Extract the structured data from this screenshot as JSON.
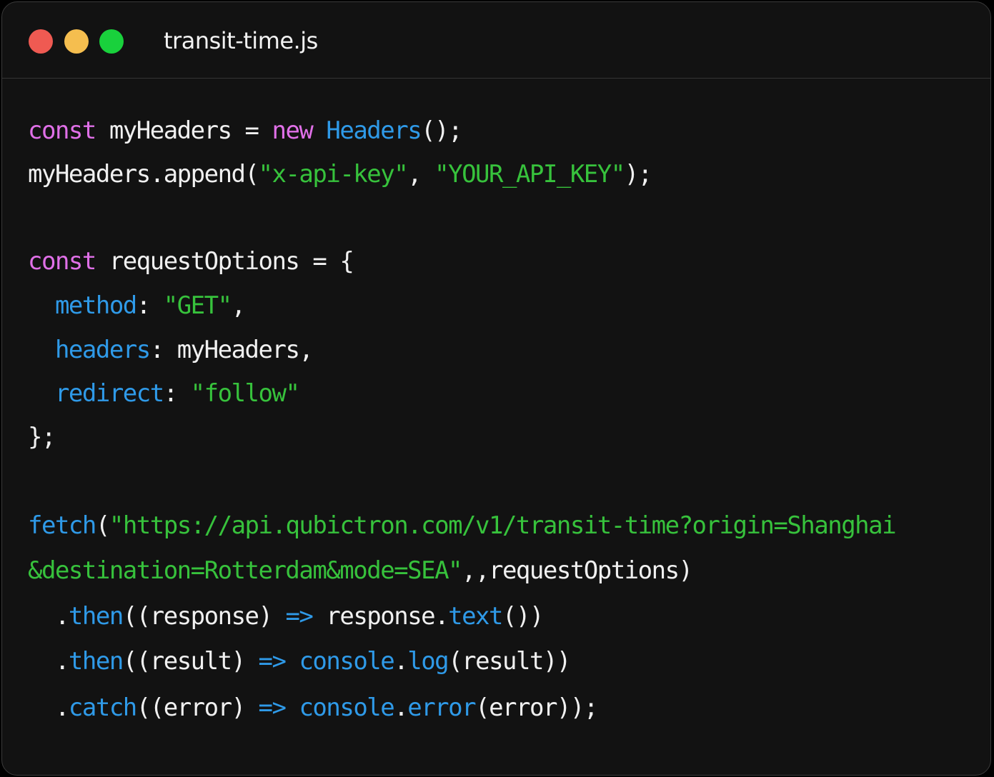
{
  "window": {
    "title": "transit-time.js"
  },
  "colors": {
    "keyword": "#e070e8",
    "function": "#2f9ae8",
    "string": "#37c23c",
    "plain": "#f0f0f0",
    "background": "#121212",
    "close": "#ef5a52",
    "minimize": "#f5be4f",
    "maximize": "#19d13c"
  },
  "code": {
    "lines": [
      {
        "tokens": [
          {
            "t": "const",
            "c": "kw"
          },
          {
            "t": " myHeaders = ",
            "c": "pl"
          },
          {
            "t": "new",
            "c": "kw"
          },
          {
            "t": " ",
            "c": "pl"
          },
          {
            "t": "Headers",
            "c": "fn"
          },
          {
            "t": "();",
            "c": "pl"
          }
        ]
      },
      {
        "tokens": [
          {
            "t": "myHeaders.append(",
            "c": "pl"
          },
          {
            "t": "\"x-api-key\"",
            "c": "str"
          },
          {
            "t": ", ",
            "c": "pl"
          },
          {
            "t": "\"YOUR_API_KEY\"",
            "c": "str"
          },
          {
            "t": ");",
            "c": "pl"
          }
        ]
      },
      {
        "tokens": []
      },
      {
        "tokens": [
          {
            "t": "const",
            "c": "kw"
          },
          {
            "t": " requestOptions = {",
            "c": "pl"
          }
        ]
      },
      {
        "tokens": [
          {
            "t": "  ",
            "c": "pl"
          },
          {
            "t": "method",
            "c": "fn"
          },
          {
            "t": ": ",
            "c": "pl"
          },
          {
            "t": "\"GET\"",
            "c": "str"
          },
          {
            "t": ",",
            "c": "pl"
          }
        ]
      },
      {
        "tokens": [
          {
            "t": "  ",
            "c": "pl"
          },
          {
            "t": "headers",
            "c": "fn"
          },
          {
            "t": ": myHeaders,",
            "c": "pl"
          }
        ]
      },
      {
        "tokens": [
          {
            "t": "  ",
            "c": "pl"
          },
          {
            "t": "redirect",
            "c": "fn"
          },
          {
            "t": ": ",
            "c": "pl"
          },
          {
            "t": "\"follow\"",
            "c": "str"
          }
        ]
      },
      {
        "tokens": [
          {
            "t": "};",
            "c": "pl"
          }
        ]
      },
      {
        "tokens": []
      },
      {
        "tokens": [
          {
            "t": "fetch",
            "c": "fn"
          },
          {
            "t": "(",
            "c": "pl"
          },
          {
            "t": "\"https://api.qubictron.com/v1/transit-time?origin=Shanghai",
            "c": "str"
          }
        ]
      },
      {
        "tokens": [
          {
            "t": "&destination=Rotterdam&mode=SEA\"",
            "c": "str"
          },
          {
            "t": ",,requestOptions)",
            "c": "pl"
          }
        ]
      },
      {
        "tokens": [
          {
            "t": "  .",
            "c": "pl"
          },
          {
            "t": "then",
            "c": "fn"
          },
          {
            "t": "((response) ",
            "c": "pl"
          },
          {
            "t": "=>",
            "c": "fn"
          },
          {
            "t": " response.",
            "c": "pl"
          },
          {
            "t": "text",
            "c": "fn"
          },
          {
            "t": "())",
            "c": "pl"
          }
        ]
      },
      {
        "tokens": [
          {
            "t": "  .",
            "c": "pl"
          },
          {
            "t": "then",
            "c": "fn"
          },
          {
            "t": "((result) ",
            "c": "pl"
          },
          {
            "t": "=>",
            "c": "fn"
          },
          {
            "t": " ",
            "c": "pl"
          },
          {
            "t": "console",
            "c": "fn"
          },
          {
            "t": ".",
            "c": "pl"
          },
          {
            "t": "log",
            "c": "fn"
          },
          {
            "t": "(result))",
            "c": "pl"
          }
        ]
      },
      {
        "tokens": [
          {
            "t": "  .",
            "c": "pl"
          },
          {
            "t": "catch",
            "c": "fn"
          },
          {
            "t": "((error) ",
            "c": "pl"
          },
          {
            "t": "=>",
            "c": "fn"
          },
          {
            "t": " ",
            "c": "pl"
          },
          {
            "t": "console",
            "c": "fn"
          },
          {
            "t": ".",
            "c": "pl"
          },
          {
            "t": "error",
            "c": "fn"
          },
          {
            "t": "(error));",
            "c": "pl"
          }
        ]
      }
    ]
  }
}
